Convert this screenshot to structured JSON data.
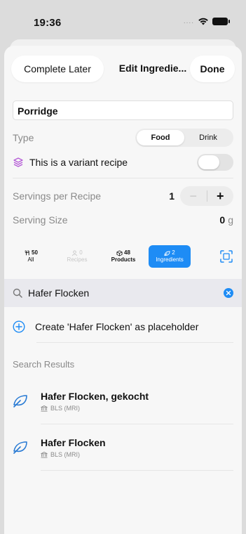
{
  "status": {
    "time": "19:36",
    "signal": "...."
  },
  "header": {
    "complete_later": "Complete Later",
    "title": "Edit Ingredie...",
    "done": "Done"
  },
  "recipe_name": "Porridge",
  "type": {
    "label": "Type",
    "options": [
      "Food",
      "Drink"
    ],
    "selected": "Food"
  },
  "variant": {
    "label": "This is a variant recipe",
    "enabled": false
  },
  "servings": {
    "label": "Servings per Recipe",
    "value": "1",
    "minus": "−",
    "plus": "+"
  },
  "serving_size": {
    "label": "Serving Size",
    "value": "0",
    "unit": "g"
  },
  "filters": [
    {
      "count": "50",
      "label": "All",
      "icon": "all-icon",
      "state": "normal"
    },
    {
      "count": "0",
      "label": "Recipes",
      "icon": "person-icon",
      "state": "disabled"
    },
    {
      "count": "48",
      "label": "Products",
      "icon": "box-icon",
      "state": "normal"
    },
    {
      "count": "2",
      "label": "Ingredients",
      "icon": "leaf-icon",
      "state": "active"
    }
  ],
  "search": {
    "query": "Hafer Flocken"
  },
  "placeholder_action": "Create 'Hafer Flocken' as placeholder",
  "results_title": "Search Results",
  "results": [
    {
      "title": "Hafer Flocken, gekocht",
      "source": "BLS (MRI)"
    },
    {
      "title": "Hafer Flocken",
      "source": "BLS (MRI)"
    }
  ],
  "colors": {
    "accent": "#1e8cf5",
    "variant_icon": "#b45bd6",
    "leaf": "#2a7bd4"
  }
}
